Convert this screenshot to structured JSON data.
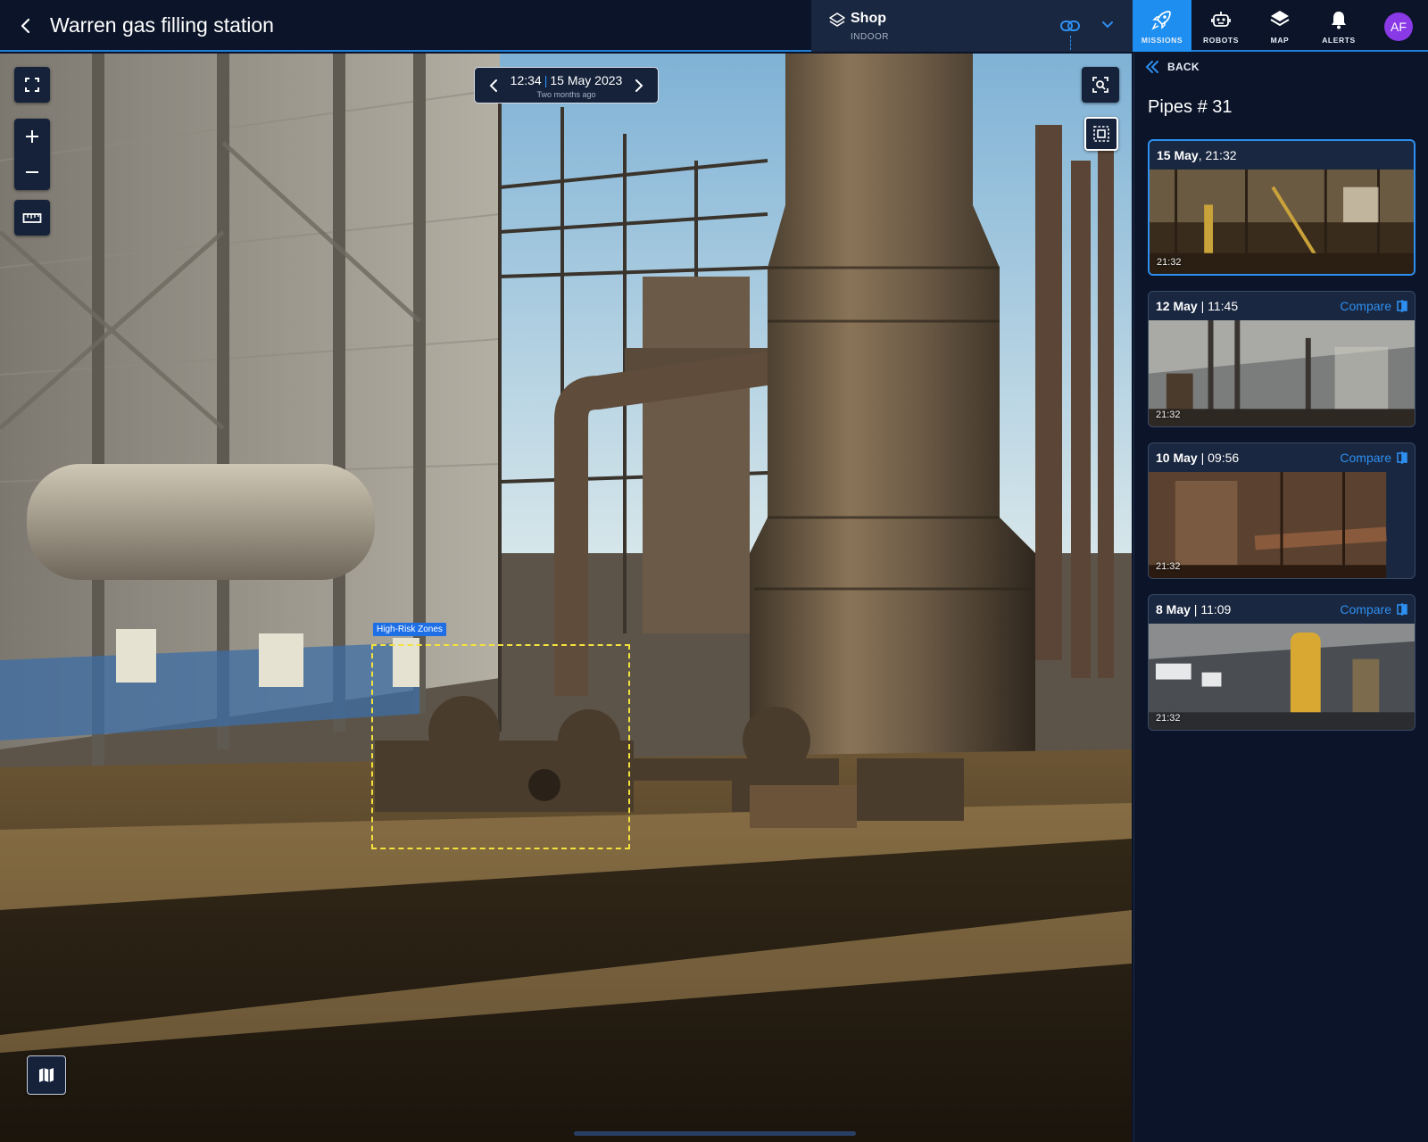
{
  "header": {
    "title": "Warren gas filling station",
    "layer": {
      "name": "Shop",
      "type": "INDOOR"
    }
  },
  "nav": [
    {
      "label": "MISSIONS",
      "icon": "rocket-icon",
      "active": true
    },
    {
      "label": "ROBOTS",
      "icon": "robot-icon",
      "active": false
    },
    {
      "label": "MAP",
      "icon": "layers-icon",
      "active": false
    },
    {
      "label": "ALERTS",
      "icon": "bell-icon",
      "active": false
    }
  ],
  "user": {
    "initials": "AF",
    "color": "#8a39e6"
  },
  "viewer": {
    "time": "12:34",
    "date": "15 May 2023",
    "relative": "Two months ago",
    "zone_label": "High-Risk Zones"
  },
  "panel": {
    "back_label": "BACK",
    "title": "Pipes # 31",
    "cards": [
      {
        "date": "15 May",
        "sep": ", ",
        "time": "21:32",
        "thumb_time": "21:32",
        "compare": "",
        "selected": true
      },
      {
        "date": "12 May",
        "sep": " | ",
        "time": "11:45",
        "thumb_time": "21:32",
        "compare": "Compare",
        "selected": false
      },
      {
        "date": "10 May",
        "sep": " | ",
        "time": "09:56",
        "thumb_time": "21:32",
        "compare": "Compare",
        "selected": false
      },
      {
        "date": "8 May",
        "sep": " | ",
        "time": "11:09",
        "thumb_time": "21:32",
        "compare": "Compare",
        "selected": false
      }
    ]
  },
  "colors": {
    "accent": "#2d8ff0",
    "background": "#0b1428",
    "zone": "#f3e23d"
  }
}
